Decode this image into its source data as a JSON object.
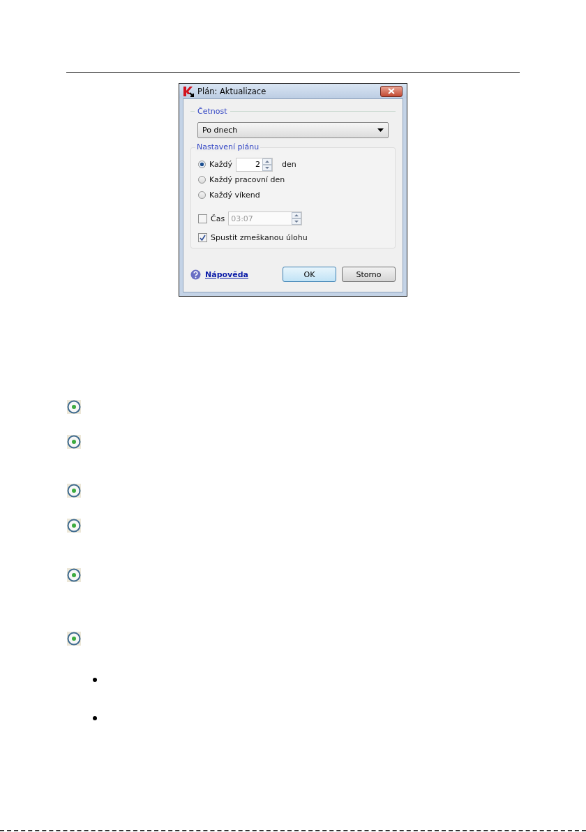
{
  "page": {
    "dialog": {
      "title": "Plán: Aktualizace",
      "frequency": {
        "label": "Četnost",
        "value": "Po dnech"
      },
      "schedule": {
        "label": "Nastavení plánu",
        "options": [
          {
            "kind": "spin",
            "label": "Každý",
            "selected": true,
            "value": "2",
            "unit": "den"
          },
          {
            "kind": "plain",
            "label": "Každý pracovní den",
            "selected": false
          },
          {
            "kind": "plain",
            "label": "Každý víkend",
            "selected": false
          }
        ],
        "time": {
          "label": "Čas",
          "checked": false,
          "value": "03:07",
          "disabled": true
        },
        "run_missed": {
          "label": "Spustit zmeškanou úlohu",
          "checked": true
        }
      },
      "help_link": "Nápověda",
      "buttons": [
        {
          "label": "OK",
          "default": true
        },
        {
          "label": "Storno",
          "default": false
        }
      ]
    },
    "bullets": [
      {
        "kind": "marker"
      },
      {
        "kind": "marker"
      },
      {
        "kind": "marker"
      },
      {
        "kind": "marker"
      },
      {
        "kind": "marker"
      },
      {
        "kind": "marker"
      },
      {
        "kind": "dot"
      },
      {
        "kind": "dot"
      }
    ]
  }
}
